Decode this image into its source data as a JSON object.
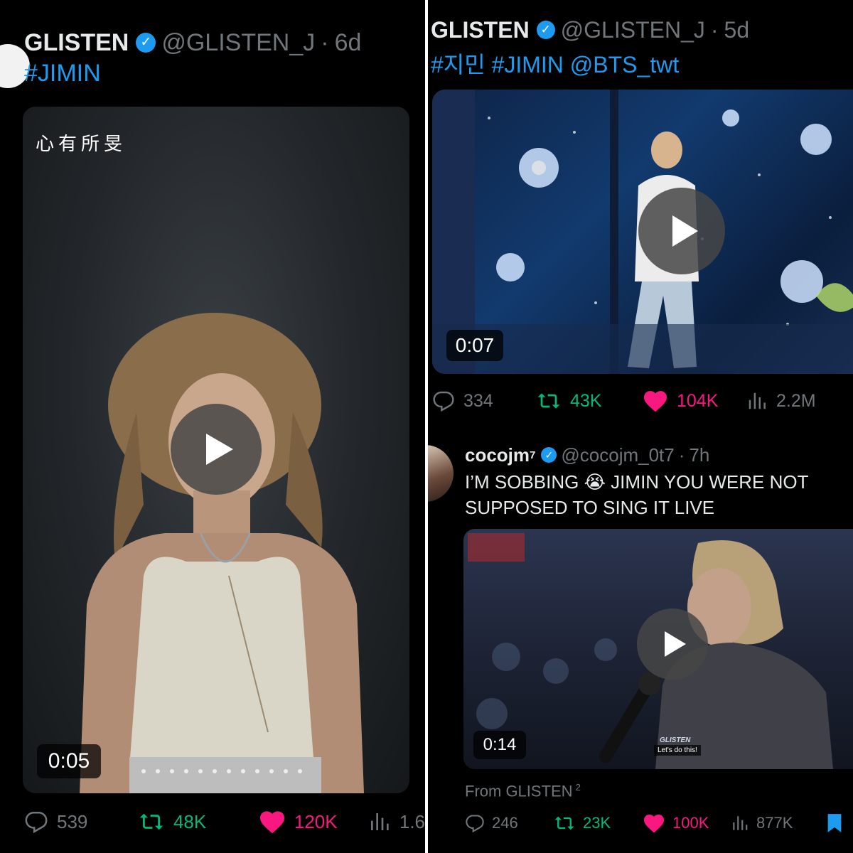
{
  "left_tweet": {
    "author_name": "GLISTEN",
    "author_handle": "@GLISTEN_J",
    "separator": "·",
    "time": "6d",
    "hashtags": "#JIMIN",
    "media": {
      "overlay_text": "心有所旻",
      "duration": "0:05"
    },
    "stats": {
      "replies": "539",
      "retweets": "48K",
      "likes": "120K",
      "views": "1.6"
    }
  },
  "right_tweet": {
    "author_name": "GLISTEN",
    "author_handle": "@GLISTEN_J",
    "separator": "·",
    "time": "5d",
    "hashtags": "#지민 #JIMIN @BTS_twt",
    "media": {
      "duration": "0:07"
    },
    "stats": {
      "replies": "334",
      "retweets": "43K",
      "likes": "104K",
      "views": "2.2M"
    }
  },
  "quoted_tweet": {
    "author_name": "cocojm",
    "author_name_sup": "7",
    "author_handle": "@cocojm_0t7",
    "separator": "·",
    "time": "7h",
    "text_line1": "I’M SOBBING 😭 JIMIN YOU WERE NOT",
    "text_line2": "SUPPOSED TO SING IT LIVE",
    "media": {
      "duration": "0:14",
      "watermark": "GLISTEN",
      "subtitle": "Let's do this!"
    },
    "from_label": "From GLISTEN",
    "from_sup": "2",
    "stats": {
      "replies": "246",
      "retweets": "23K",
      "likes": "100K",
      "views": "877K"
    }
  },
  "colors": {
    "background": "#000000",
    "link_blue": "#1d9bf0",
    "retweet_green": "#00ba7c",
    "like_pink": "#f91880",
    "muted_grey": "#71767b"
  },
  "icons": [
    "verified-badge-icon",
    "reply-icon",
    "retweet-icon",
    "heart-icon",
    "views-icon",
    "bookmark-icon",
    "play-icon"
  ]
}
